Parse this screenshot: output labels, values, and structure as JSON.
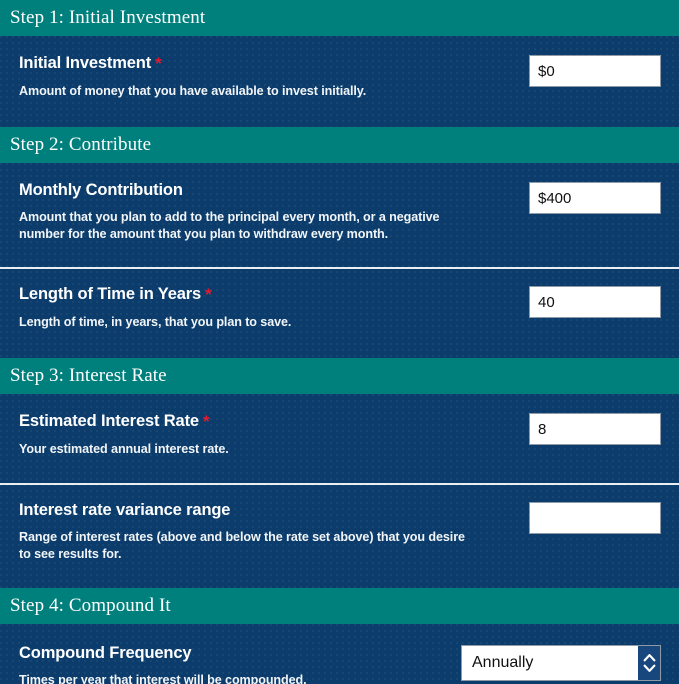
{
  "steps": [
    {
      "header": "Step 1: Initial Investment",
      "fields": [
        {
          "label": "Initial Investment",
          "required_marker": "*",
          "description": "Amount of money that you have available to invest initially.",
          "value": "$0",
          "placeholder": "",
          "control": "text"
        }
      ]
    },
    {
      "header": "Step 2: Contribute",
      "fields": [
        {
          "label": "Monthly Contribution",
          "required_marker": "",
          "description": "Amount that you plan to add to the principal every month, or a negative number for the amount that you plan to withdraw every month.",
          "value": "$400",
          "placeholder": "",
          "control": "text"
        },
        {
          "label": "Length of Time in Years",
          "required_marker": "*",
          "description": "Length of time, in years, that you plan to save.",
          "value": "40",
          "placeholder": "",
          "control": "text"
        }
      ]
    },
    {
      "header": "Step 3: Interest Rate",
      "fields": [
        {
          "label": "Estimated Interest Rate",
          "required_marker": "*",
          "description": "Your estimated annual interest rate.",
          "value": "8",
          "placeholder": "",
          "control": "text"
        },
        {
          "label": "Interest rate variance range",
          "required_marker": "",
          "description": "Range of interest rates (above and below the rate set above) that you desire to see results for.",
          "value": "",
          "placeholder": "",
          "control": "text"
        }
      ]
    },
    {
      "header": "Step 4: Compound It",
      "fields": [
        {
          "label": "Compound Frequency",
          "required_marker": "",
          "description": "Times per year that interest will be compounded.",
          "value": "Annually",
          "placeholder": "",
          "control": "select"
        }
      ]
    }
  ],
  "icons": {
    "spinner_up": "chevron-up-icon",
    "spinner_down": "chevron-down-icon"
  },
  "colors": {
    "step_header_bg": "#00807c",
    "panel_bg": "#0b3c6b",
    "required_marker": "#e8192c",
    "spinner_bg": "#17477d",
    "separator": "#e9eef3"
  }
}
